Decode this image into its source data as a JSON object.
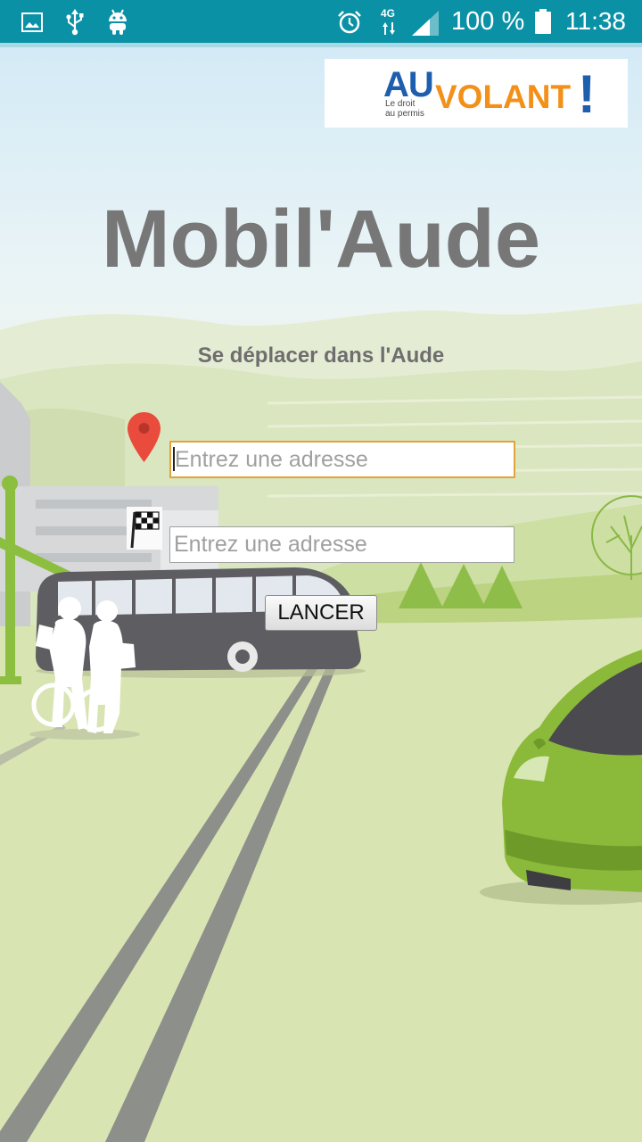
{
  "status_bar": {
    "left_icons": [
      "image-icon",
      "usb-icon",
      "android-icon"
    ],
    "right_icons": [
      "alarm-icon",
      "signal-icon",
      "battery-icon"
    ],
    "network": "4G",
    "battery": "100 %",
    "time": "11:38",
    "background_color": "#0b91a6"
  },
  "logo": {
    "brand_prefix": "AU",
    "brand_main": "VOLANT",
    "brand_mark": "!",
    "tagline": "Le droit au permis",
    "prefix_color": "#1d5fae",
    "main_color": "#f39019"
  },
  "header": {
    "title": "Mobil'Aude",
    "subtitle": "Se déplacer dans l'Aude"
  },
  "form": {
    "origin": {
      "icon": "map-pin-icon",
      "value": "",
      "placeholder": "Entrez une adresse",
      "focused": true
    },
    "destination": {
      "icon": "checkered-flag-icon",
      "value": "",
      "placeholder": "Entrez une adresse",
      "focused": false
    },
    "submit_label": "LANCER"
  },
  "colors": {
    "title": "#777777",
    "subtitle": "#6e6e6e",
    "focus_border": "#e1a33a",
    "pin": "#e94b3c",
    "car": "#8bb93a",
    "bus": "#5e5d62"
  }
}
